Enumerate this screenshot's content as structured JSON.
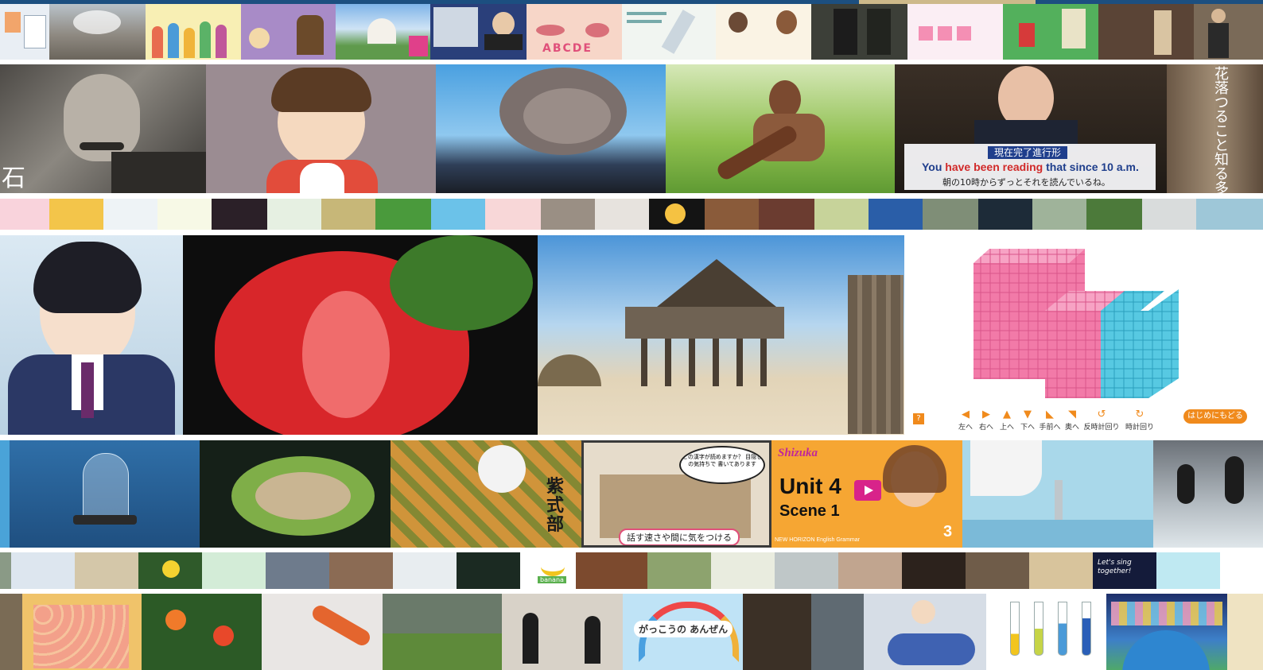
{
  "colors": {
    "accent_orange": "#f08a1c",
    "subtitle_blue": "#1f3e8c",
    "highlight_red": "#d12a2a",
    "cube_pink": "#f27aa8",
    "cube_cyan": "#57c9e2"
  },
  "row1": {
    "abc_text": "ABCDE"
  },
  "row2": {
    "portrait_char": "石",
    "subtitle_tag": "現在完了進行形",
    "subtitle_en_pre": "You ",
    "subtitle_en_red": "have been reading",
    "subtitle_en_post": " that since 10 a.m.",
    "subtitle_jp": "朝の10時からずっとそれを読んでいるね。",
    "vertical_text": "花落つること知る多少ぞ"
  },
  "cube_app": {
    "help_icon_label": "?",
    "controls": [
      "左へ",
      "右へ",
      "上へ",
      "下へ",
      "手前へ",
      "奥へ",
      "反時計回り",
      "時計回り"
    ],
    "reset_button": "はじめにもどる"
  },
  "row5": {
    "scroll_name": "紫式部",
    "speech_bubble": "この漢字が読めますか？ 目隠しの気持ちで 書いてあります",
    "classroom_caption": "話す速さや間に気をつける",
    "unit_brand": "Shizuka",
    "unit_title": "Unit 4",
    "unit_scene": "Scene 1",
    "unit_number": "3",
    "unit_footer": "NEW HORIZON English Grammar"
  },
  "row6": {
    "banana_label": "banana",
    "song_label": "Let's sing together!"
  },
  "row7": {
    "rainbow_label": "がっこうの あんぜん"
  }
}
